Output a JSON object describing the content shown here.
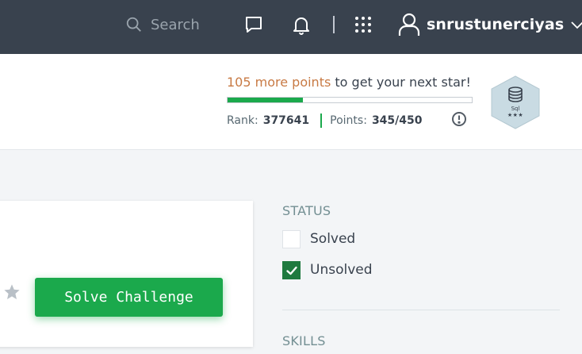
{
  "topbar": {
    "search_placeholder": "Search",
    "username": "snrustunerciyas",
    "icons": [
      "search-icon",
      "messages-icon",
      "notifications-icon",
      "apps-grid-icon",
      "user-icon",
      "chevron-down-icon"
    ]
  },
  "progress": {
    "more_points": "105 more points",
    "next_star_text": " to get your next star!",
    "fraction": 0.307,
    "rank_label": "Rank:",
    "rank_value": "377641",
    "points_label": "Points:",
    "points_value": "345/450",
    "badge_name": "Sql",
    "badge_stars": "★★★"
  },
  "challenge": {
    "solve_label": "Solve Challenge"
  },
  "filters": {
    "status_heading": "STATUS",
    "options": [
      {
        "label": "Solved",
        "checked": false
      },
      {
        "label": "Unsolved",
        "checked": true
      }
    ],
    "skills_heading": "SKILLS"
  },
  "colors": {
    "nav_bg": "#39424e",
    "accent_green": "#1ba94c",
    "checkbox_green": "#1f7a3f",
    "points_orange": "#c87a44"
  }
}
